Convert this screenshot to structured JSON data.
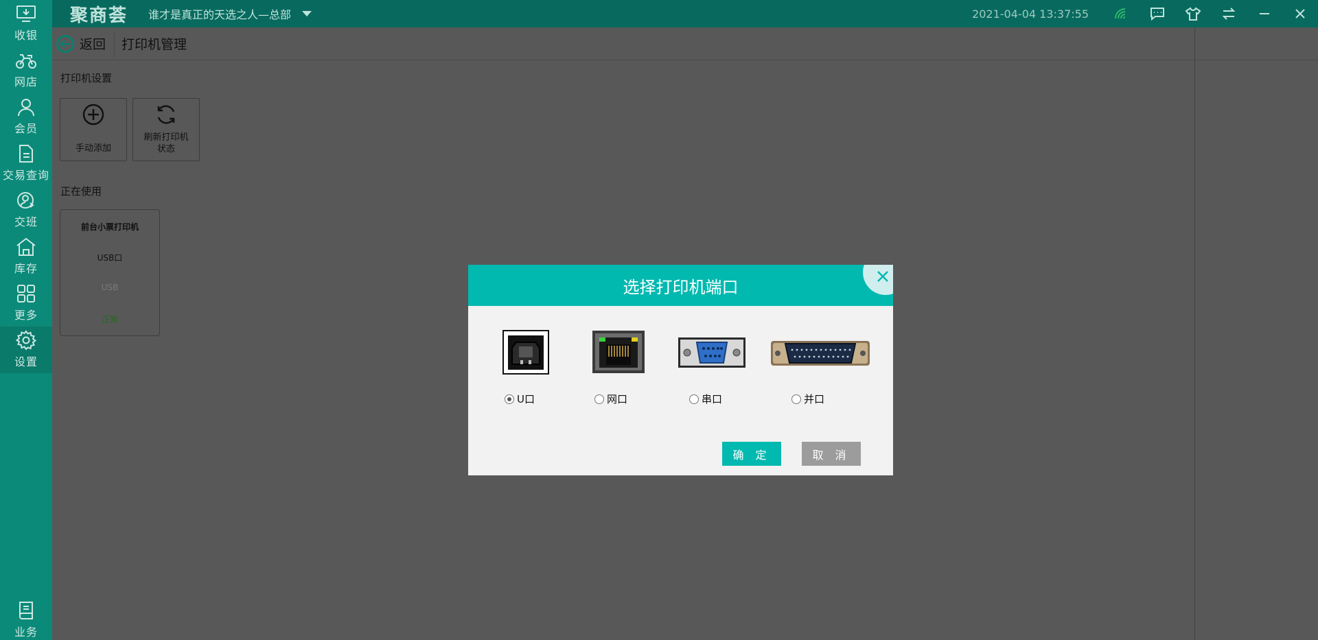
{
  "sidebar": {
    "items": [
      {
        "label": "收银",
        "icon": "cashier-icon"
      },
      {
        "label": "网店",
        "icon": "delivery-bike-icon"
      },
      {
        "label": "会员",
        "icon": "member-icon"
      },
      {
        "label": "交易查询",
        "icon": "document-icon"
      },
      {
        "label": "交班",
        "icon": "handover-icon"
      },
      {
        "label": "库存",
        "icon": "warehouse-icon"
      },
      {
        "label": "更多",
        "icon": "grid-icon"
      },
      {
        "label": "设置",
        "icon": "gear-icon"
      },
      {
        "label": "业务",
        "icon": "book-icon"
      }
    ],
    "active": "设置"
  },
  "topbar": {
    "logo": "聚商荟",
    "store": "谁才是真正的天选之人—总部",
    "datetime": "2021-04-04 13:37:55"
  },
  "header": {
    "back_label": "返回",
    "title": "打印机管理"
  },
  "settings": {
    "section_label": "打印机设置",
    "manual_add": "手动添加",
    "refresh_line1": "刷新打印机",
    "refresh_line2": "状态"
  },
  "in_use": {
    "section_label": "正在使用",
    "printer": {
      "name": "前台小票打印机",
      "port": "USB口",
      "type": "USB",
      "status": "正常"
    }
  },
  "dialog": {
    "title": "选择打印机端口",
    "ports": [
      {
        "label": "U口",
        "checked": true,
        "icon": "usb-port-icon"
      },
      {
        "label": "网口",
        "checked": false,
        "icon": "ethernet-port-icon"
      },
      {
        "label": "串口",
        "checked": false,
        "icon": "serial-port-icon"
      },
      {
        "label": "并口",
        "checked": false,
        "icon": "parallel-port-icon"
      }
    ],
    "ok_label": "确 定",
    "cancel_label": "取 消"
  },
  "colors": {
    "accent": "#02b9b0",
    "sidebar": "#0b8a79",
    "topbar": "#086a5e",
    "status_ok": "#1f6d1f"
  }
}
